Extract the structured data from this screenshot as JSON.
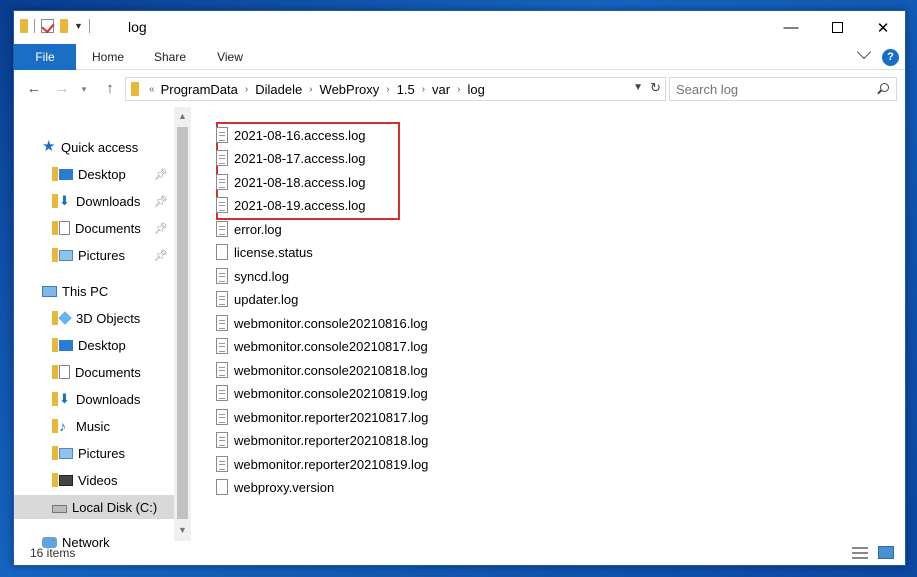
{
  "window": {
    "title": "log"
  },
  "ribbon": {
    "tabs": {
      "file": "File",
      "home": "Home",
      "share": "Share",
      "view": "View"
    }
  },
  "address": {
    "more": "«",
    "crumbs": [
      "ProgramData",
      "Diladele",
      "WebProxy",
      "1.5",
      "var",
      "log"
    ]
  },
  "search": {
    "placeholder": "Search log"
  },
  "sidebar": {
    "quick_access": "Quick access",
    "quick_items": [
      "Desktop",
      "Downloads",
      "Documents",
      "Pictures"
    ],
    "this_pc": "This PC",
    "pc_items": [
      "3D Objects",
      "Desktop",
      "Documents",
      "Downloads",
      "Music",
      "Pictures",
      "Videos",
      "Local Disk (C:)"
    ],
    "network": "Network"
  },
  "files": [
    "2021-08-16.access.log",
    "2021-08-17.access.log",
    "2021-08-18.access.log",
    "2021-08-19.access.log",
    "error.log",
    "license.status",
    "syncd.log",
    "updater.log",
    "webmonitor.console20210816.log",
    "webmonitor.console20210817.log",
    "webmonitor.console20210818.log",
    "webmonitor.console20210819.log",
    "webmonitor.reporter20210817.log",
    "webmonitor.reporter20210818.log",
    "webmonitor.reporter20210819.log",
    "webproxy.version"
  ],
  "status": {
    "count": "16 items"
  },
  "colors": {
    "accent": "#1a6fc4",
    "highlight": "#d32f2f",
    "selected": "#d9d9d9"
  }
}
